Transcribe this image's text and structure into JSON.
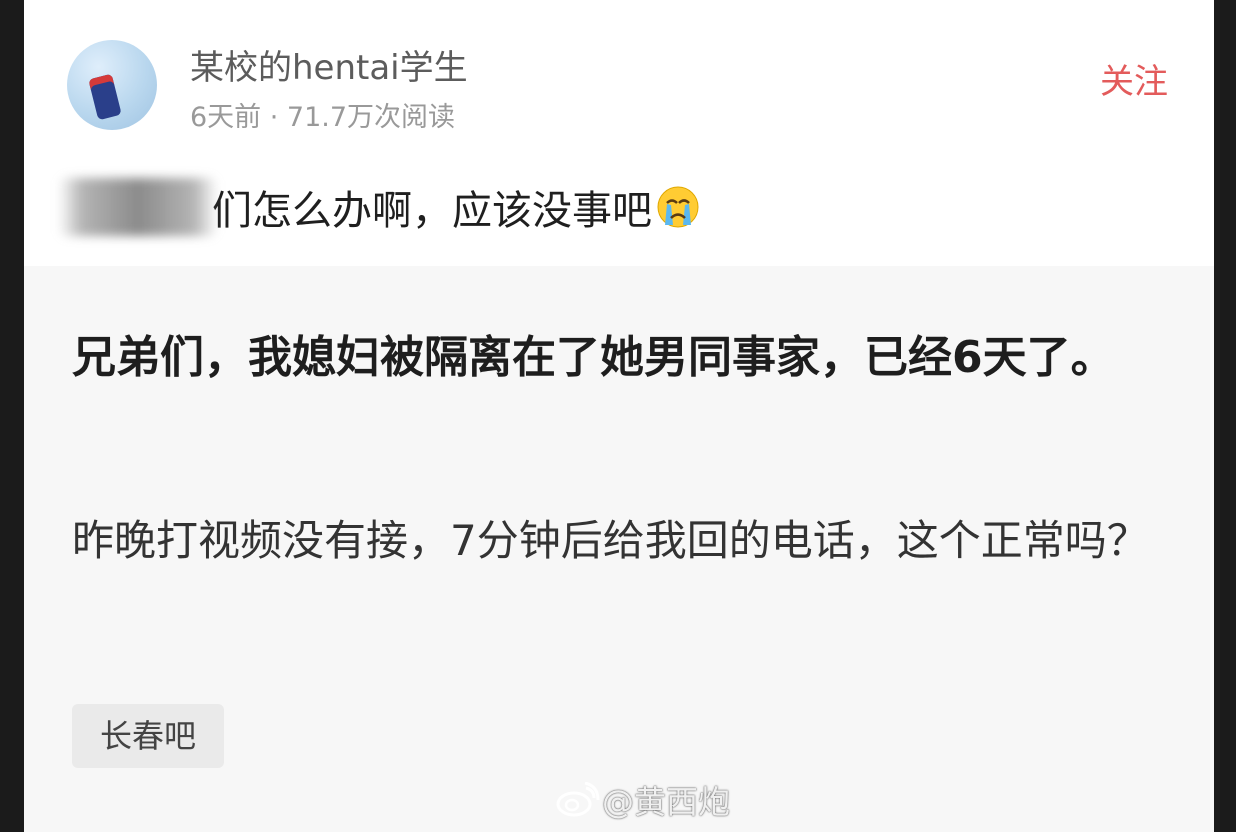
{
  "post": {
    "author": "某校的hentai学生",
    "meta": "6天前 · 71.7万次阅读",
    "follow_label": "关注",
    "title": "们怎么办啊，应该没事吧",
    "title_emoji": "crying-face-icon",
    "headline": "兄弟们，我媳妇被隔离在了她男同事家，已经6天了。",
    "body": "昨晚打视频没有接，7分钟后给我回的电话，这个正常吗？",
    "tag": "长春吧"
  },
  "watermark": {
    "icon": "weibo-icon",
    "text": "@黄西炮"
  },
  "colors": {
    "accent": "#e35b5b",
    "background": "#f7f7f7",
    "header_bg": "#ffffff"
  }
}
